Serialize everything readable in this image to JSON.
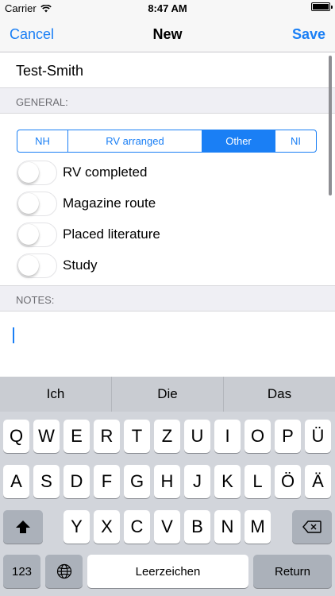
{
  "status_bar": {
    "carrier": "Carrier",
    "time": "8:47 AM",
    "battery_level": 1.0
  },
  "nav": {
    "cancel_label": "Cancel",
    "title": "New",
    "save_label": "Save"
  },
  "form": {
    "name_value": "Test-Smith",
    "general_header": "GENERAL:",
    "segments": [
      {
        "label": "NH",
        "selected": false
      },
      {
        "label": "RV arranged",
        "selected": false
      },
      {
        "label": "Other",
        "selected": true
      },
      {
        "label": "NI",
        "selected": false
      }
    ],
    "toggles": [
      {
        "label": "RV completed",
        "on": false
      },
      {
        "label": "Magazine route",
        "on": false
      },
      {
        "label": "Placed literature",
        "on": false
      },
      {
        "label": "Study",
        "on": false
      }
    ],
    "notes_header": "NOTES:",
    "notes_value": ""
  },
  "keyboard": {
    "suggestions": [
      "Ich",
      "Die",
      "Das"
    ],
    "row1": [
      "Q",
      "W",
      "E",
      "R",
      "T",
      "Z",
      "U",
      "I",
      "O",
      "P",
      "Ü"
    ],
    "row2": [
      "A",
      "S",
      "D",
      "F",
      "G",
      "H",
      "J",
      "K",
      "L",
      "Ö",
      "Ä"
    ],
    "row3": [
      "Y",
      "X",
      "C",
      "V",
      "B",
      "N",
      "M"
    ],
    "numbers_label": "123",
    "space_label": "Leerzeichen",
    "return_label": "Return"
  },
  "colors": {
    "accent": "#1a7ff5",
    "keyboard_bg": "#d2d5db",
    "section_bg": "#efeff4"
  }
}
